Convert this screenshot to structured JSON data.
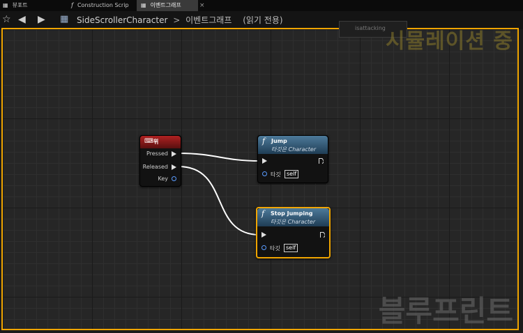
{
  "tabs": [
    {
      "label": "뷰포트",
      "active": false
    },
    {
      "label": "Construction Scrip",
      "active": false,
      "icon": "function-icon"
    },
    {
      "label": "이벤트그래프",
      "active": true,
      "icon": "event-graph-icon"
    }
  ],
  "tab_close_glyph": "×",
  "breadcrumb": {
    "blueprint": "SideScrollerCharacter",
    "separator": ">",
    "graph": "이벤트그래프",
    "mode": "(읽기 전용)"
  },
  "ghost_node_label": "isattacking",
  "simulation_label": "시뮬레이션 중",
  "watermark": "블루프린트",
  "nodes": {
    "event": {
      "title": "위",
      "pins": {
        "pressed": "Pressed",
        "released": "Released",
        "key": "Key"
      }
    },
    "jump": {
      "title": "Jump",
      "subtitle": "타깃은 Character",
      "target_label": "타깃",
      "target_value": "self"
    },
    "stop": {
      "title": "Stop Jumping",
      "subtitle": "타깃은 Character",
      "target_label": "타깃",
      "target_value": "self"
    }
  },
  "colors": {
    "accent": "#f0a500",
    "event_header": "#b02121",
    "function_header": "#4d7a9a",
    "object_pin": "#5a9cff"
  }
}
